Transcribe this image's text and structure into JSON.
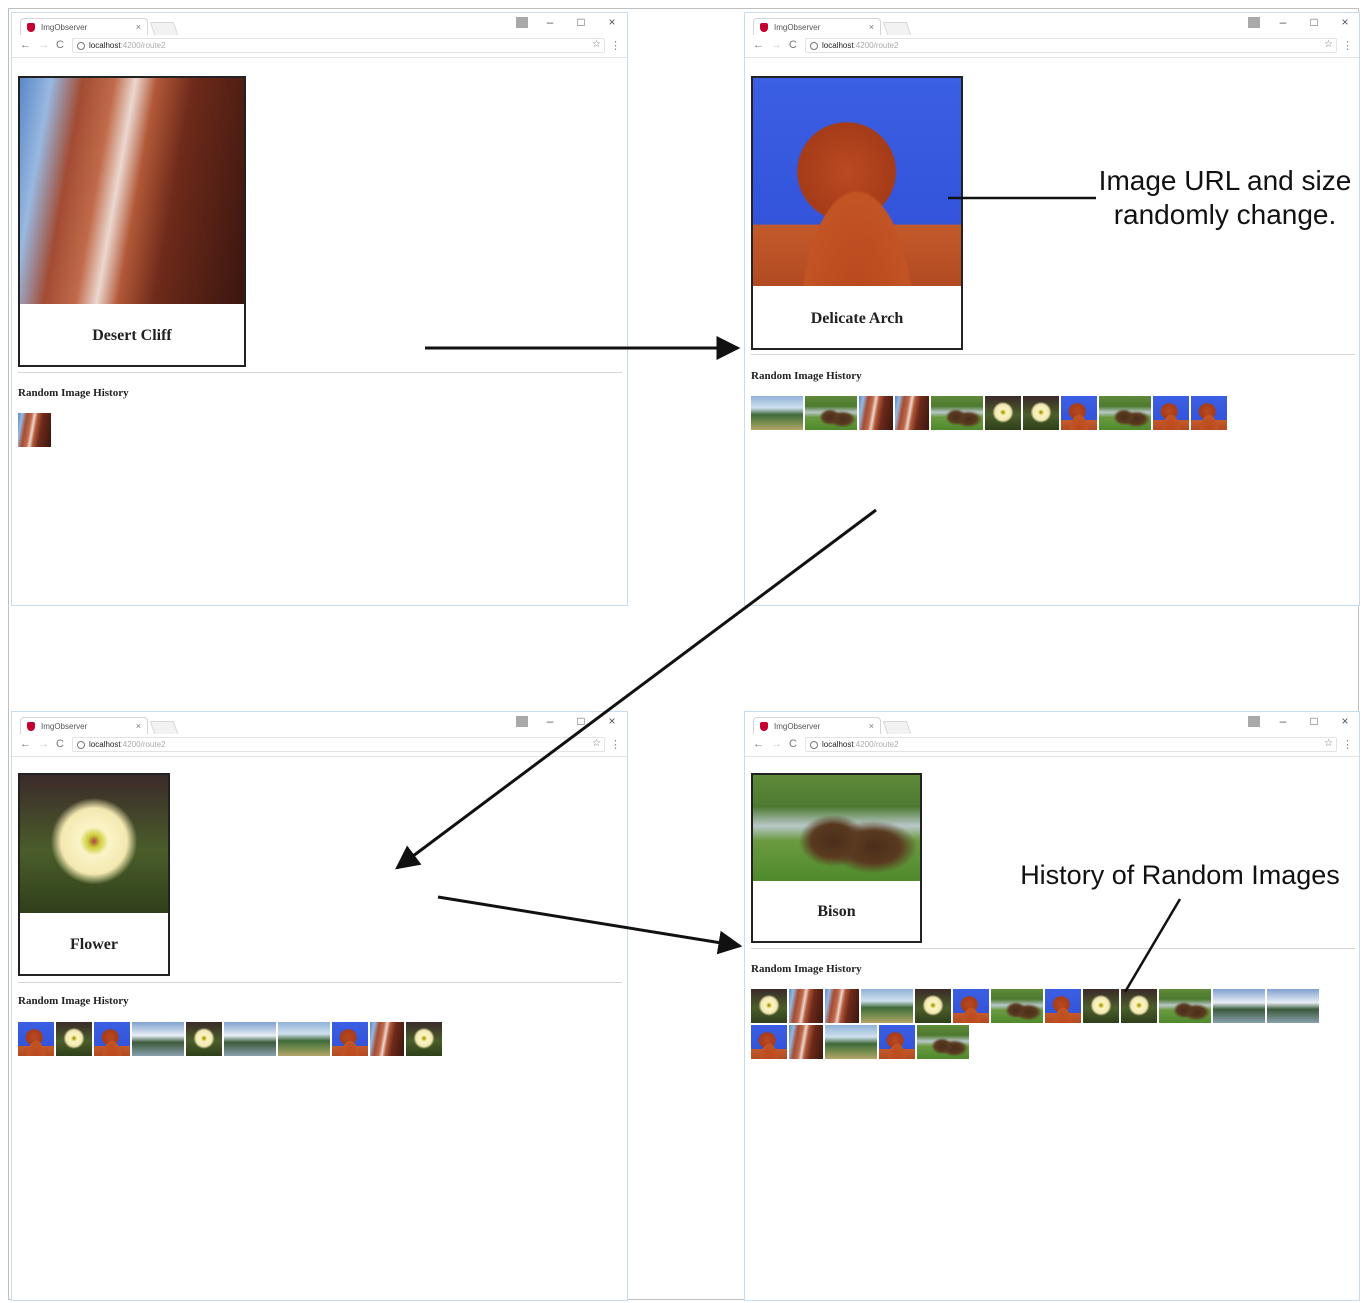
{
  "windows": [
    {
      "id": "top-left",
      "tab_title": "ImgObserver",
      "url_host": "localhost",
      "url_path": ":4200/route2",
      "card_caption": "Desert Cliff",
      "card_image": "cliff",
      "history_title": "Random Image History",
      "history": [
        "cliff"
      ]
    },
    {
      "id": "top-right",
      "tab_title": "ImgObserver",
      "url_host": "localhost",
      "url_path": ":4200/route2",
      "card_caption": "Delicate Arch",
      "card_image": "arch",
      "history_title": "Random Image History",
      "history": [
        "valley",
        "bison",
        "cliff",
        "cliff",
        "bison",
        "flower",
        "flower",
        "arch",
        "bison",
        "arch",
        "arch"
      ]
    },
    {
      "id": "bottom-left",
      "tab_title": "ImgObserver",
      "url_host": "localhost",
      "url_path": ":4200/route2",
      "card_caption": "Flower",
      "card_image": "flower",
      "history_title": "Random Image History",
      "history": [
        "arch",
        "flower",
        "arch",
        "mtn",
        "flower",
        "mtn",
        "valley",
        "arch",
        "cliff",
        "flower"
      ]
    },
    {
      "id": "bottom-right",
      "tab_title": "ImgObserver",
      "url_host": "localhost",
      "url_path": ":4200/route2",
      "card_caption": "Bison",
      "card_image": "bison",
      "history_title": "Random Image History",
      "history": [
        "flower",
        "cliff",
        "cliff",
        "valley",
        "flower",
        "arch",
        "bison",
        "arch",
        "flower",
        "flower",
        "bison",
        "mtn",
        "mtn",
        "arch",
        "cliff",
        "valley",
        "arch",
        "bison"
      ]
    }
  ],
  "annotations": {
    "top": "Image URL and size randomly change.",
    "bottom": "History of Random Images"
  },
  "icons": {
    "window_controls": [
      "minimize-icon",
      "maximize-icon",
      "close-icon"
    ],
    "nav": [
      "back-arrow-icon",
      "forward-arrow-icon",
      "reload-icon"
    ]
  }
}
